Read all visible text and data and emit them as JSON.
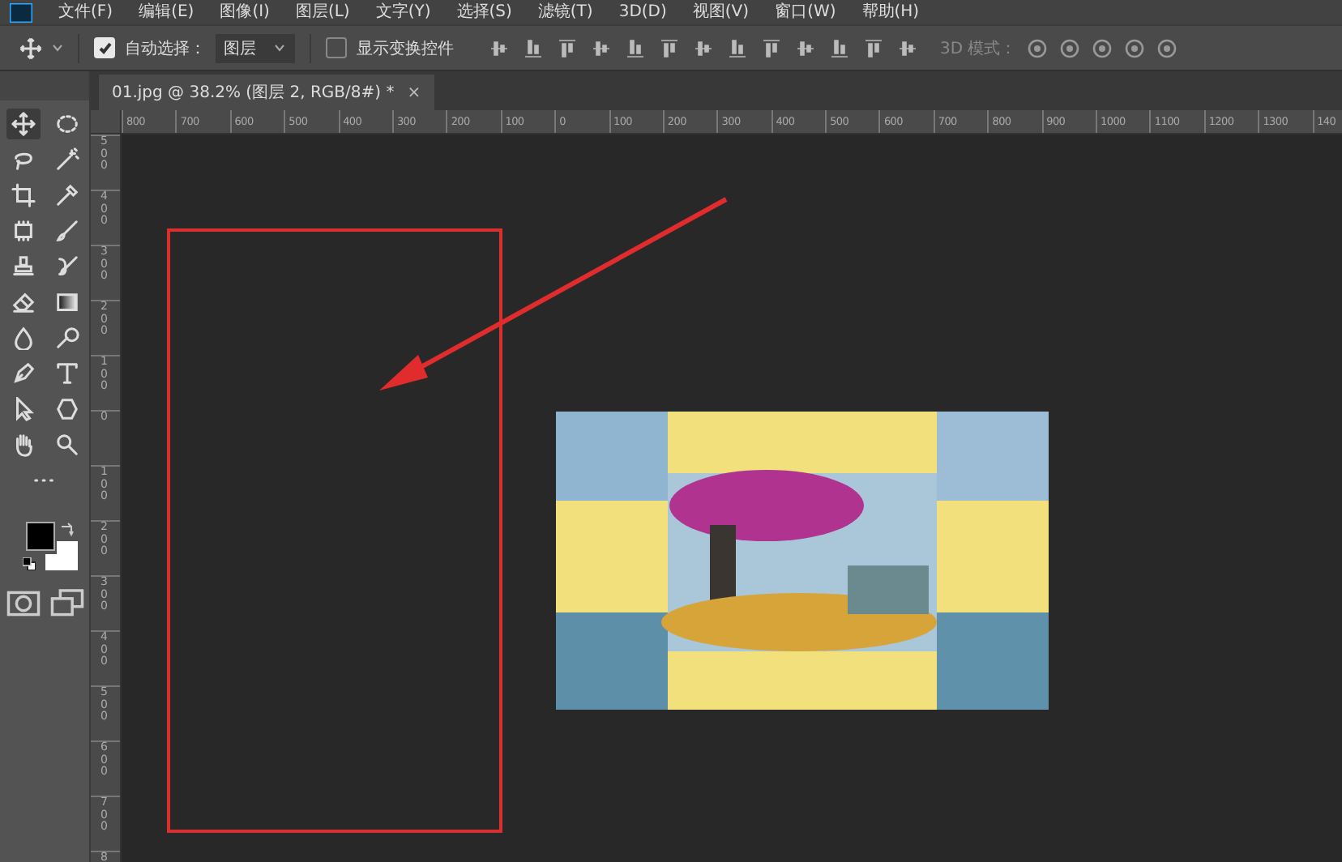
{
  "menu": [
    "文件(F)",
    "编辑(E)",
    "图像(I)",
    "图层(L)",
    "文字(Y)",
    "选择(S)",
    "滤镜(T)",
    "3D(D)",
    "视图(V)",
    "窗口(W)",
    "帮助(H)"
  ],
  "options": {
    "auto_select": {
      "label": "自动选择：",
      "checked": true
    },
    "layer_dropdown": {
      "value": "图层"
    },
    "show_transform": {
      "label": "显示变换控件",
      "checked": false
    },
    "mode_3d_label": "3D 模式："
  },
  "document_tab": {
    "title": "01.jpg @ 38.2% (图层 2, RGB/8#) *",
    "close": "×"
  },
  "tools": [
    {
      "kind": "move",
      "selected": true
    },
    {
      "kind": "marquee",
      "selected": false
    },
    {
      "kind": "lasso",
      "selected": false
    },
    {
      "kind": "wand",
      "selected": false
    },
    {
      "kind": "crop",
      "selected": false
    },
    {
      "kind": "eyedropper",
      "selected": false
    },
    {
      "kind": "patch",
      "selected": false
    },
    {
      "kind": "brush",
      "selected": false
    },
    {
      "kind": "stamp",
      "selected": false
    },
    {
      "kind": "history",
      "selected": false
    },
    {
      "kind": "eraser",
      "selected": false
    },
    {
      "kind": "gradient",
      "selected": false
    },
    {
      "kind": "drop",
      "selected": false
    },
    {
      "kind": "dodge",
      "selected": false
    },
    {
      "kind": "pen",
      "selected": false
    },
    {
      "kind": "type",
      "selected": false
    },
    {
      "kind": "select",
      "selected": false
    },
    {
      "kind": "shape",
      "selected": false
    },
    {
      "kind": "hand",
      "selected": false
    },
    {
      "kind": "zoom",
      "selected": false
    },
    {
      "kind": "more",
      "selected": false
    }
  ],
  "ruler_h": [
    "800",
    "700",
    "600",
    "500",
    "400",
    "300",
    "200",
    "100",
    "0",
    "100",
    "200",
    "300",
    "400",
    "500",
    "600",
    "700",
    "800",
    "900",
    "1000",
    "1100",
    "1200",
    "1300",
    "140"
  ],
  "ruler_v": [
    "500",
    "400",
    "300",
    "200",
    "100",
    "0",
    "100",
    "200",
    "300",
    "400",
    "500",
    "600",
    "700",
    "8"
  ]
}
